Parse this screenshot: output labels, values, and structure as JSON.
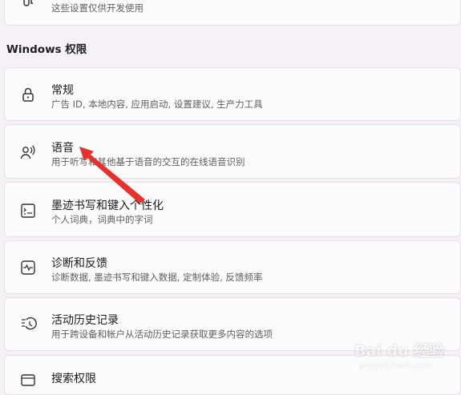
{
  "top_partial": {
    "desc": "这些设置仅供开发使用",
    "icon": "developer-tools-icon"
  },
  "section_header": "Windows 权限",
  "items": [
    {
      "title": "常规",
      "desc": "广告 ID, 本地内容, 应用启动, 设置建议, 生产力工具",
      "icon": "lock-icon"
    },
    {
      "title": "语音",
      "desc": "用于听写和其他基于语音的交互的在线语音识别",
      "icon": "speech-icon"
    },
    {
      "title": "墨迹书写和键入个性化",
      "desc": "个人词典，词典中的字词",
      "icon": "ink-typing-icon"
    },
    {
      "title": "诊断和反馈",
      "desc": "诊断数据, 墨迹书写和键入数据, 定制体验, 反馈频率",
      "icon": "diagnostics-icon"
    },
    {
      "title": "活动历史记录",
      "desc": "用于跨设备和帐户从活动历史记录获取更多内容的选项",
      "icon": "history-icon"
    },
    {
      "title": "搜索权限",
      "icon": "search-permissions-icon"
    }
  ],
  "annotation": {
    "color": "#e8312a",
    "icon": "red-arrow-annotation"
  },
  "watermark": {
    "line1": "Bai du 经验",
    "line2": "jingyan.baidu.com"
  }
}
